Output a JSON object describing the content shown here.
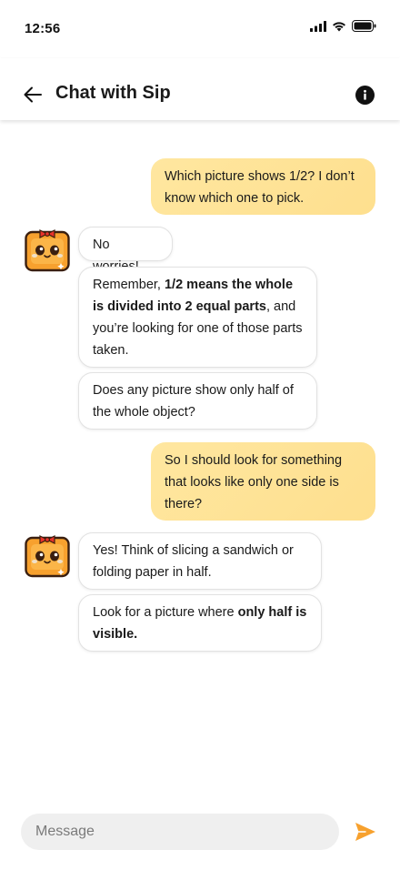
{
  "status": {
    "time": "12:56"
  },
  "header": {
    "title": "Chat with Sip"
  },
  "messages": [
    {
      "sender": "user",
      "text": "Which picture shows 1/2? I don’t know which one to pick."
    },
    {
      "sender": "bot",
      "text": "No worries!"
    },
    {
      "sender": "bot",
      "parts": [
        "Remember, ",
        "1/2 means the whole is divided into 2 equal parts",
        ", and you’re looking for one of those parts taken."
      ]
    },
    {
      "sender": "bot",
      "text": "Does any picture show only half of the whole object?"
    },
    {
      "sender": "user",
      "text": "So I should look for something that looks like only one side is there?"
    },
    {
      "sender": "bot",
      "text": "Yes! Think of slicing a sandwich or folding paper in half."
    },
    {
      "sender": "bot",
      "parts": [
        "Look for a picture where ",
        "only half is visible."
      ]
    }
  ],
  "composer": {
    "placeholder": "Message"
  },
  "colors": {
    "user_bubble": "#fee39a",
    "send_accent": "#f7a12e",
    "avatar_orange": "#f7a12e",
    "avatar_bow": "#e8332a"
  },
  "icons": [
    "back-arrow-icon",
    "info-icon",
    "send-icon",
    "signal-icon",
    "wifi-icon",
    "battery-icon"
  ]
}
